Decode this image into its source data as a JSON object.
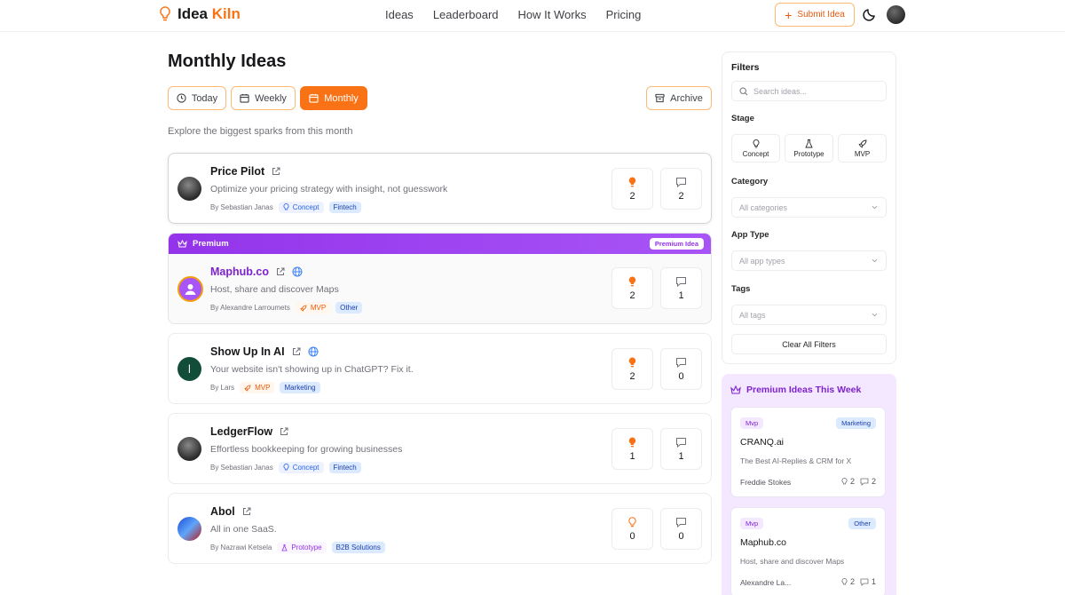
{
  "header": {
    "logo_part1": "Idea",
    "logo_part2": "Kiln",
    "nav": [
      "Ideas",
      "Leaderboard",
      "How It Works",
      "Pricing"
    ],
    "submit_label": "Submit Idea",
    "icons": [
      "lightbulb-icon",
      "plus-icon",
      "moon-icon"
    ]
  },
  "main": {
    "title": "Monthly Ideas",
    "periods": {
      "today": "Today",
      "weekly": "Weekly",
      "monthly": "Monthly",
      "active": "monthly"
    },
    "archive_label": "Archive",
    "subtitle": "Explore the biggest sparks from this month",
    "premium_label": "Premium",
    "premium_pill": "Premium Idea",
    "ideas": [
      {
        "title": "Price Pilot",
        "desc": "Optimize your pricing strategy with insight, not guesswork",
        "author": "By Sebastian Janas",
        "stage": "Concept",
        "category": "Fintech",
        "votes": "2",
        "comments": "2"
      },
      {
        "title": "Maphub.co",
        "desc": "Host, share and discover Maps",
        "author": "By Alexandre Larroumets",
        "stage": "MVP",
        "category": "Other",
        "votes": "2",
        "comments": "1",
        "premium": true
      },
      {
        "title": "Show Up In AI",
        "desc": "Your website isn't showing up in ChatGPT? Fix it.",
        "author": "By Lars",
        "stage": "MVP",
        "category": "Marketing",
        "votes": "2",
        "comments": "0",
        "avatar_letter": "l"
      },
      {
        "title": "LedgerFlow",
        "desc": "Effortless bookkeeping for growing businesses",
        "author": "By Sebastian Janas",
        "stage": "Concept",
        "category": "Fintech",
        "votes": "1",
        "comments": "1"
      },
      {
        "title": "Abol",
        "desc": "All in one SaaS.",
        "author": "By Nazrawi Ketsela",
        "stage": "Prototype",
        "category": "B2B Solutions",
        "votes": "0",
        "comments": "0"
      }
    ]
  },
  "filters": {
    "title": "Filters",
    "search_placeholder": "Search ideas...",
    "stage_label": "Stage",
    "stages": [
      "Concept",
      "Prototype",
      "MVP"
    ],
    "category_label": "Category",
    "category_value": "All categories",
    "app_type_label": "App Type",
    "app_type_value": "All app types",
    "tags_label": "Tags",
    "tags_value": "All tags",
    "clear_label": "Clear All Filters"
  },
  "premium_week": {
    "title": "Premium Ideas This Week",
    "items": [
      {
        "stage": "Mvp",
        "category": "Marketing",
        "name": "CRANQ.ai",
        "desc": "The Best AI-Replies & CRM for X",
        "author": "Freddie Stokes",
        "votes": "2",
        "comments": "2"
      },
      {
        "stage": "Mvp",
        "category": "Other",
        "name": "Maphub.co",
        "desc": "Host, share and discover Maps",
        "author": "Alexandre La...",
        "votes": "2",
        "comments": "1"
      }
    ]
  },
  "colors": {
    "accent": "#f97316",
    "premium": "#9333ea"
  }
}
